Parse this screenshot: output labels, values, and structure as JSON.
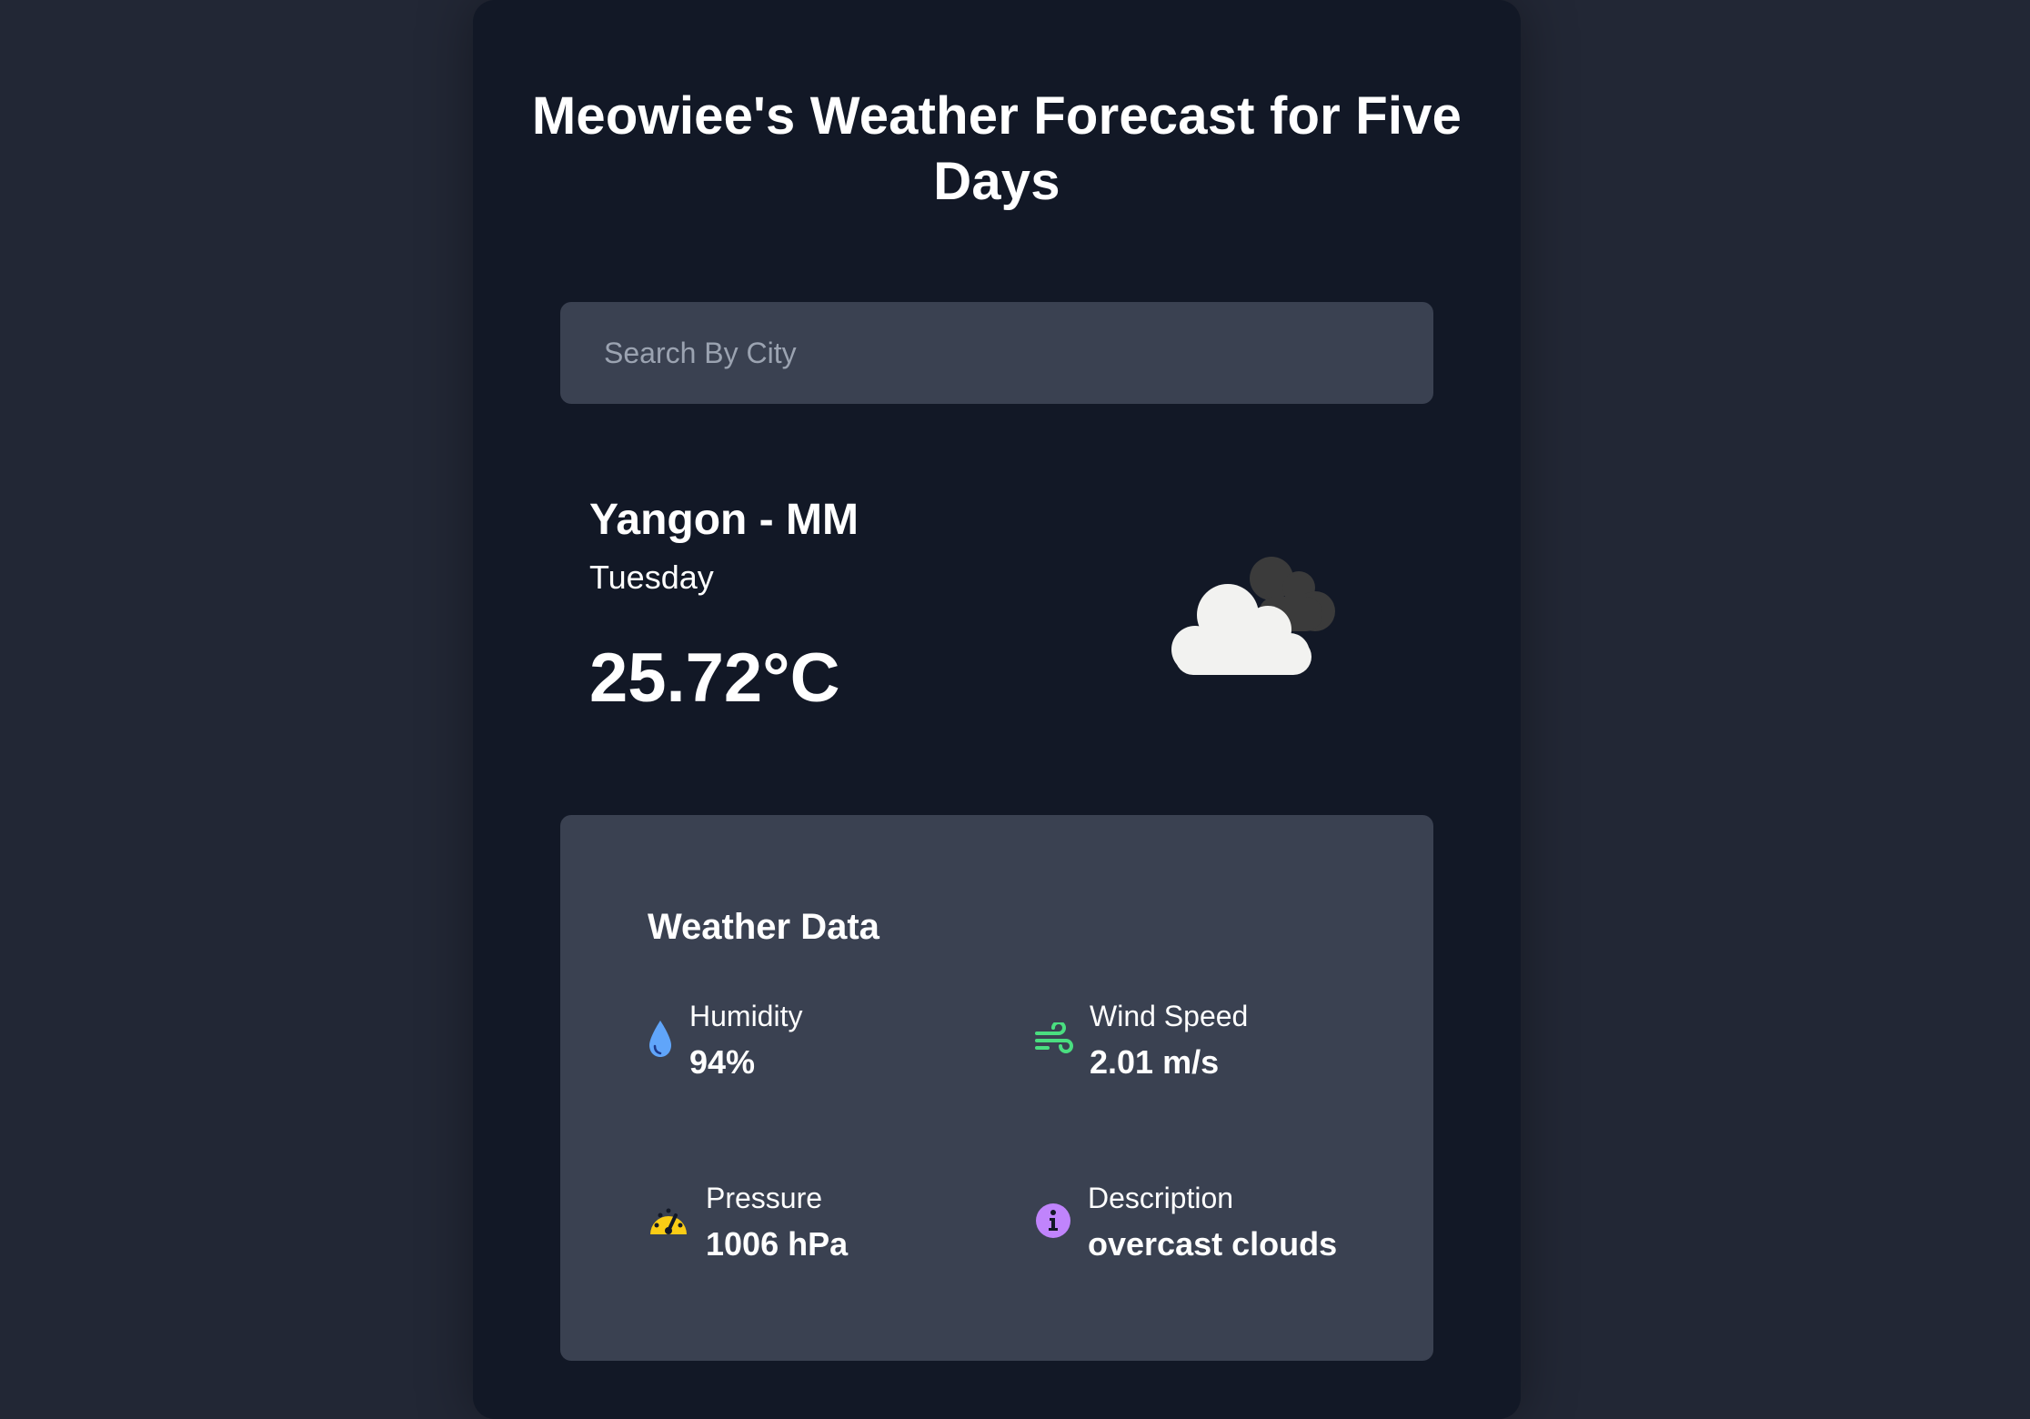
{
  "header": {
    "title": "Meowiee's Weather Forecast for Five Days"
  },
  "search": {
    "placeholder": "Search By City",
    "value": ""
  },
  "current": {
    "location": "Yangon - MM",
    "day": "Tuesday",
    "temperature": "25.72°C",
    "icon": "overcast-clouds-icon"
  },
  "weather_data": {
    "title": "Weather Data",
    "humidity": {
      "label": "Humidity",
      "value": "94%",
      "icon": "water-drop-icon",
      "color": "#60a5fa"
    },
    "wind_speed": {
      "label": "Wind Speed",
      "value": "2.01 m/s",
      "icon": "wind-icon",
      "color": "#4ade80"
    },
    "pressure": {
      "label": "Pressure",
      "value": "1006 hPa",
      "icon": "gauge-icon",
      "color": "#facc15"
    },
    "description": {
      "label": "Description",
      "value": "overcast clouds",
      "icon": "info-icon",
      "color": "#c084fc"
    }
  },
  "colors": {
    "page_background": "#222735",
    "card_background": "#121826",
    "panel_background": "#3a4151"
  }
}
